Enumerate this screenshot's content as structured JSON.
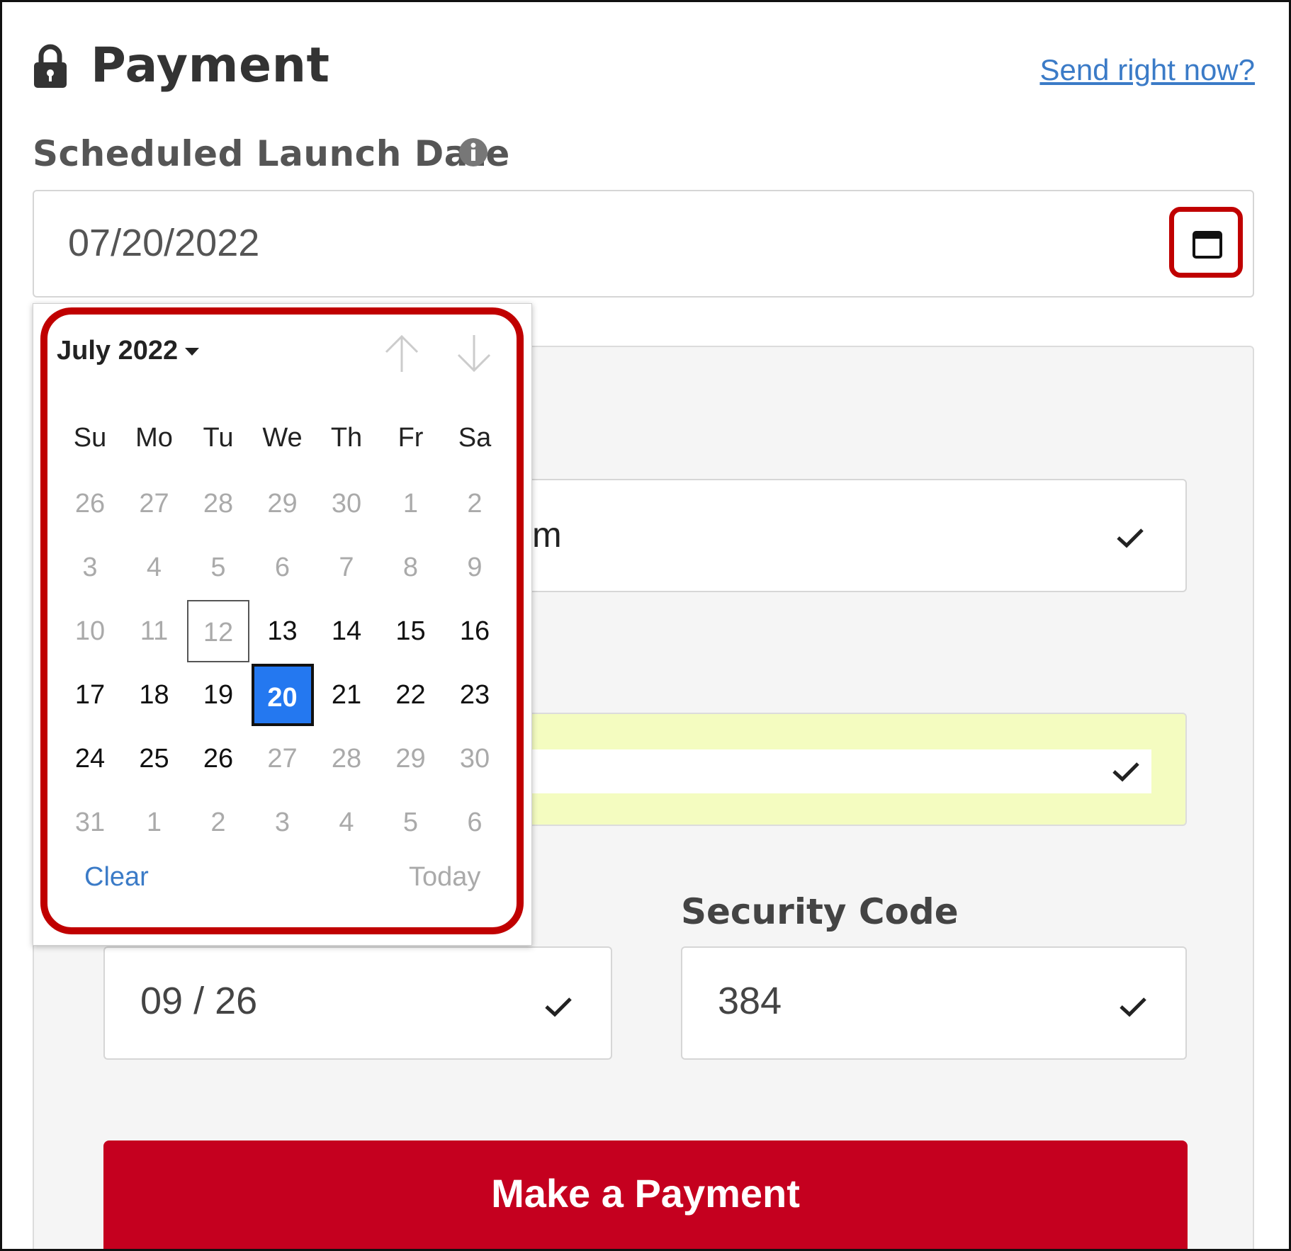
{
  "header": {
    "title": "Payment",
    "send_link": "Send right now?",
    "lock_icon": "lock-icon"
  },
  "launch_date": {
    "label": "Scheduled Launch Date",
    "value": "07/20/2022",
    "info_icon": "info-icon",
    "calendar_icon": "calendar-icon"
  },
  "datepicker": {
    "month_label": "July 2022",
    "weekdays": [
      "Su",
      "Mo",
      "Tu",
      "We",
      "Th",
      "Fr",
      "Sa"
    ],
    "weeks": [
      [
        {
          "d": "26",
          "m": true
        },
        {
          "d": "27",
          "m": true
        },
        {
          "d": "28",
          "m": true
        },
        {
          "d": "29",
          "m": true
        },
        {
          "d": "30",
          "m": true
        },
        {
          "d": "1",
          "m": true
        },
        {
          "d": "2",
          "m": true
        }
      ],
      [
        {
          "d": "3",
          "m": true
        },
        {
          "d": "4",
          "m": true
        },
        {
          "d": "5",
          "m": true
        },
        {
          "d": "6",
          "m": true
        },
        {
          "d": "7",
          "m": true
        },
        {
          "d": "8",
          "m": true
        },
        {
          "d": "9",
          "m": true
        }
      ],
      [
        {
          "d": "10",
          "m": true
        },
        {
          "d": "11",
          "m": true
        },
        {
          "d": "12",
          "m": true,
          "today": true
        },
        {
          "d": "13"
        },
        {
          "d": "14"
        },
        {
          "d": "15"
        },
        {
          "d": "16"
        }
      ],
      [
        {
          "d": "17"
        },
        {
          "d": "18"
        },
        {
          "d": "19"
        },
        {
          "d": "20",
          "selected": true
        },
        {
          "d": "21"
        },
        {
          "d": "22"
        },
        {
          "d": "23"
        }
      ],
      [
        {
          "d": "24"
        },
        {
          "d": "25"
        },
        {
          "d": "26"
        },
        {
          "d": "27",
          "m": true
        },
        {
          "d": "28",
          "m": true
        },
        {
          "d": "29",
          "m": true
        },
        {
          "d": "30",
          "m": true
        }
      ],
      [
        {
          "d": "31",
          "m": true
        },
        {
          "d": "1",
          "m": true
        },
        {
          "d": "2",
          "m": true
        },
        {
          "d": "3",
          "m": true
        },
        {
          "d": "4",
          "m": true
        },
        {
          "d": "5",
          "m": true
        },
        {
          "d": "6",
          "m": true
        }
      ]
    ],
    "clear_label": "Clear",
    "today_label": "Today",
    "selected_color": "#2478f0"
  },
  "form": {
    "email_partial": "m",
    "expiry_value": "09 / 26",
    "security_label": "Security Code",
    "security_value": "384",
    "submit_label": "Make a Payment",
    "submit_color": "#c5001f",
    "autofill_color": "#f4fcc0",
    "highlight_color": "#c00000"
  }
}
